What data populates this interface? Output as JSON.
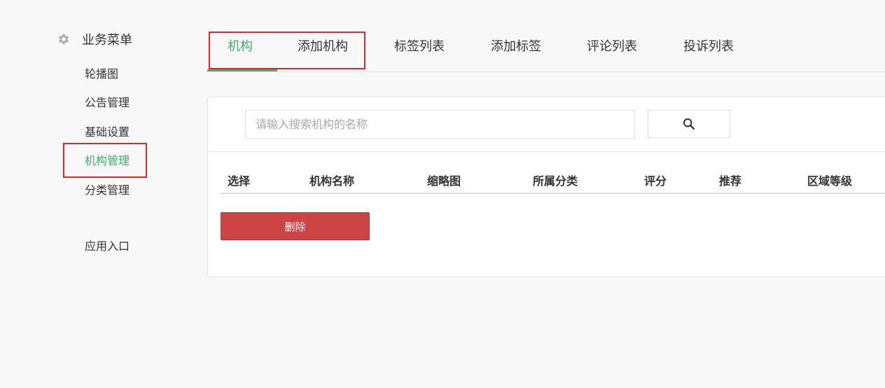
{
  "sidebar": {
    "menu_title": "业务菜单",
    "items": [
      {
        "label": "轮播图"
      },
      {
        "label": "公告管理"
      },
      {
        "label": "基础设置"
      },
      {
        "label": "机构管理"
      },
      {
        "label": "分类管理"
      },
      {
        "label": "应用入口"
      }
    ]
  },
  "tabs": [
    {
      "label": "机构"
    },
    {
      "label": "添加机构"
    },
    {
      "label": "标签列表"
    },
    {
      "label": "添加标签"
    },
    {
      "label": "评论列表"
    },
    {
      "label": "投诉列表"
    }
  ],
  "search": {
    "placeholder": "请输入搜索机构的名称",
    "value": ""
  },
  "table": {
    "columns": [
      "选择",
      "机构名称",
      "缩略图",
      "所属分类",
      "评分",
      "推荐",
      "区域等级"
    ]
  },
  "actions": {
    "delete_label": "删除"
  },
  "colors": {
    "accent": "#3db06a",
    "danger": "#cc4444",
    "highlight": "#e0272e"
  },
  "icons": {
    "menu": "gear-icon",
    "search": "search-icon"
  }
}
